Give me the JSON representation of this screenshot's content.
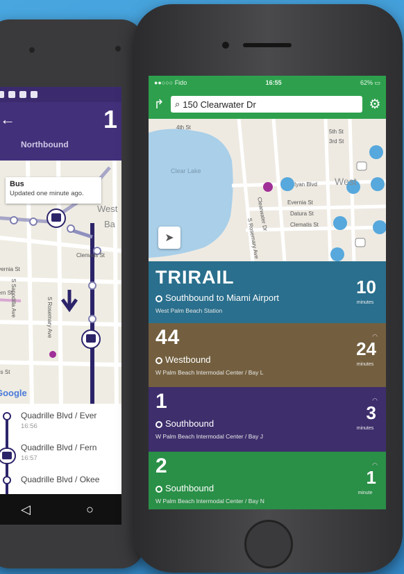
{
  "android": {
    "route_number": "1",
    "direction": "Northbound",
    "back_icon": "arrow-left-icon",
    "bus_popup": {
      "title": "Bus",
      "subtitle": "Updated one minute ago."
    },
    "map_labels": [
      "Clematis St",
      "S Sapodilla Ave",
      "S Rosemary Ave",
      "Fern St",
      "Iris St",
      "Evernia St",
      "West",
      "Ba"
    ],
    "google": "Google",
    "stops": [
      {
        "name": "Quadrille Blvd / Ever",
        "time": "16:56"
      },
      {
        "name": "Quadrille Blvd / Fern",
        "time": "16:57"
      },
      {
        "name": "Quadrille Blvd / Okee",
        "time": ""
      }
    ],
    "nav_icons": [
      "back-triangle-icon",
      "home-circle-icon"
    ]
  },
  "iphone": {
    "status": {
      "carrier": "Fido",
      "time": "16:55",
      "battery": "62%"
    },
    "search_value": "150 Clearwater Dr",
    "map_labels": [
      "Clear Lake",
      "Clearwater Dr",
      "S Rosemary Ave",
      "Evernia St",
      "Datura St",
      "Clematis St",
      "4th St",
      "5th St",
      "3rd St",
      "Iyan Blvd",
      "West"
    ],
    "cards": [
      {
        "brand": "TRI-RAIL",
        "head_display": "TRIRAIL",
        "direction": "Southbound to Miami Airport",
        "stop": "West Palm Beach Station",
        "minutes": "10",
        "unit": "minutes",
        "color": "#2a6f8d"
      },
      {
        "head": "44",
        "direction": "Westbound",
        "stop": "W Palm Beach Intermodal Center / Bay L",
        "minutes": "24",
        "unit": "minutes",
        "color": "#735f3f"
      },
      {
        "head": "1",
        "direction": "Southbound",
        "stop": "W Palm Beach Intermodal Center / Bay J",
        "minutes": "3",
        "unit": "minutes",
        "color": "#3e2e6c"
      },
      {
        "head": "2",
        "direction": "Southbound",
        "stop": "W Palm Beach Intermodal Center / Bay N",
        "minutes": "1",
        "unit": "minute",
        "color": "#2a8f47"
      }
    ]
  }
}
